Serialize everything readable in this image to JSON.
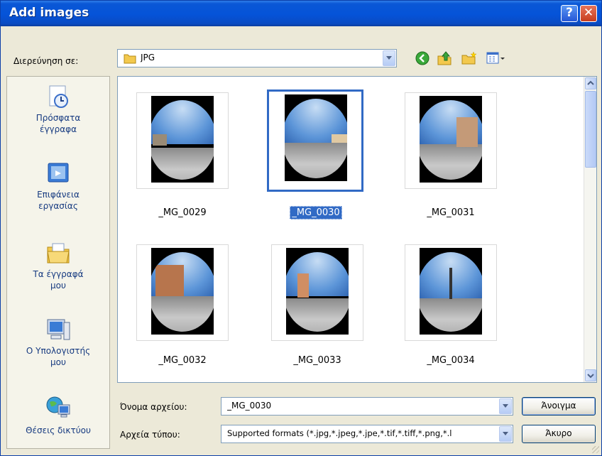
{
  "window": {
    "title": "Add images",
    "help_label": "?",
    "close_label": "✕"
  },
  "lookin": {
    "label": "Διερεύνηση σε:",
    "value": "JPG"
  },
  "places": [
    {
      "label": "Πρόσφατα έγγραφα",
      "icon": "recent-documents-icon"
    },
    {
      "label": "Επιφάνεια εργασίας",
      "icon": "desktop-icon"
    },
    {
      "label": "Τα έγγραφά μου",
      "icon": "my-documents-icon"
    },
    {
      "label": "Ο Υπολογιστής μου",
      "icon": "my-computer-icon"
    },
    {
      "label": "Θέσεις δικτύου",
      "icon": "network-places-icon"
    }
  ],
  "files": [
    {
      "name": "_MG_0029",
      "selected": false
    },
    {
      "name": "_MG_0030",
      "selected": true
    },
    {
      "name": "_MG_0031",
      "selected": false
    },
    {
      "name": "_MG_0032",
      "selected": false
    },
    {
      "name": "_MG_0033",
      "selected": false
    },
    {
      "name": "_MG_0034",
      "selected": false
    }
  ],
  "filename": {
    "label": "Όνομα αρχείου:",
    "value": "_MG_0030"
  },
  "filetype": {
    "label": "Αρχεία τύπου:",
    "value": "Supported formats (*.jpg,*.jpeg,*.jpe,*.tif,*.tiff,*.png,*.l"
  },
  "buttons": {
    "open": "Άνοιγμα",
    "cancel": "Άκυρο"
  },
  "colors": {
    "titlebar": "#0553d8",
    "selection": "#316ac5",
    "dialog_bg": "#ece9d8"
  }
}
